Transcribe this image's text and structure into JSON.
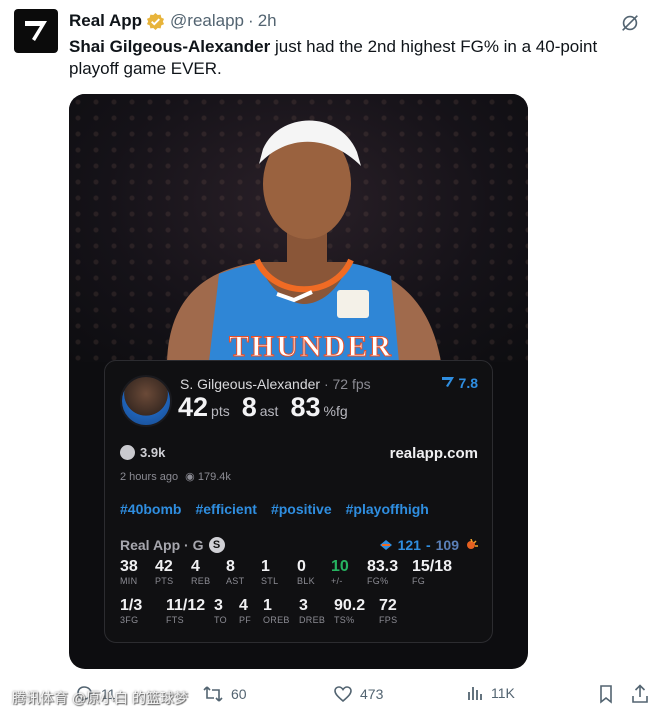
{
  "tweet": {
    "author_name": "Real App",
    "handle": "@realapp",
    "separator": "·",
    "time": "2h",
    "text_bold": "Shai Gilgeous-Alexander",
    "text_rest": " just had the 2nd highest FG% in a 40-point playoff game EVER."
  },
  "card": {
    "player_name": "S. Gilgeous-Alexander",
    "fps_text": " · 72 fps",
    "rating": "7.8",
    "pts": "42",
    "pts_unit": "pts",
    "ast": "8",
    "ast_unit": "ast",
    "fg": "83",
    "fg_unit": "%fg",
    "likes": "3.9k",
    "site": "realapp.com",
    "posted": "2 hours ago",
    "views": "179.4k",
    "tags": [
      "#40bomb",
      "#efficient",
      "#positive",
      "#playoffhigh"
    ],
    "statline_label": "Real App · G",
    "statline_badge": "S",
    "score_home": "121",
    "score_sep": "-",
    "score_away": "109",
    "stats_row1": [
      {
        "v": "38",
        "l": "MIN"
      },
      {
        "v": "42",
        "l": "PTS"
      },
      {
        "v": "4",
        "l": "REB"
      },
      {
        "v": "8",
        "l": "AST"
      },
      {
        "v": "1",
        "l": "STL"
      },
      {
        "v": "0",
        "l": "BLK"
      },
      {
        "v": "10",
        "l": "+/-"
      },
      {
        "v": "83.3",
        "l": "FG%"
      },
      {
        "v": "15/18",
        "l": "FG"
      }
    ],
    "stats_row2": [
      {
        "v": "1/3",
        "l": "3FG"
      },
      {
        "v": "11/12",
        "l": "FTS"
      },
      {
        "v": "3",
        "l": "TO"
      },
      {
        "v": "4",
        "l": "PF"
      },
      {
        "v": "1",
        "l": "OREB"
      },
      {
        "v": "3",
        "l": "DREB"
      },
      {
        "v": "90.2",
        "l": "TS%"
      },
      {
        "v": "72",
        "l": "FPS"
      }
    ]
  },
  "actions": {
    "replies": "11",
    "reposts": "60",
    "likes": "473",
    "views": "11K"
  },
  "watermark": "腾讯体育 @原小白 的篮球梦",
  "colors": {
    "accent": "#2f8ee0",
    "plus_minus": "#26b360",
    "verified": "#e8b43a"
  }
}
